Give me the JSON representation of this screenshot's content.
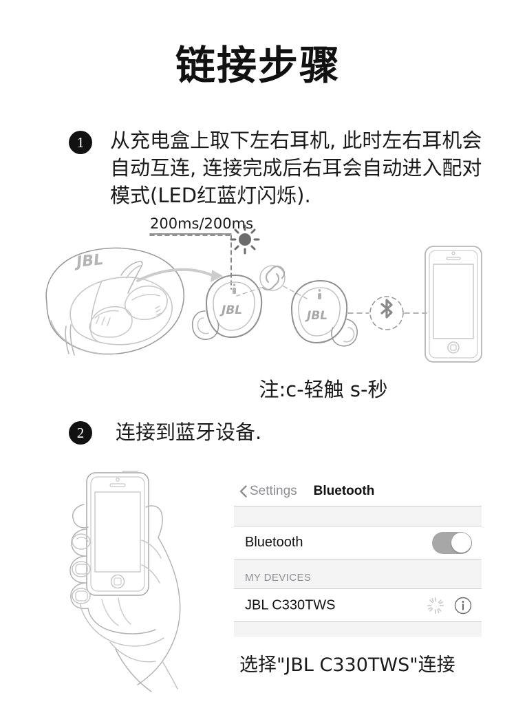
{
  "title": "链接步骤",
  "steps": [
    {
      "number": "1",
      "text": "从充电盒上取下左右耳机, 此时左右耳机会自动互连, 连接完成后右耳会自动进入配对模式(LED红蓝灯闪烁)."
    },
    {
      "number": "2",
      "text": "连接到蓝牙设备."
    }
  ],
  "diagram": {
    "blink_label": "200ms/200ms",
    "case_logo": "JBL",
    "earbud_left_logo": "JBL",
    "earbud_right_logo": "JBL"
  },
  "note": "注:c-轻触    s-秒",
  "ios": {
    "back_label": "Settings",
    "nav_title": "Bluetooth",
    "bluetooth_row_label": "Bluetooth",
    "bluetooth_toggle_state": "on",
    "section_header": "MY DEVICES",
    "device_name": "JBL  C330TWS",
    "device_status": "connecting"
  },
  "caption": "选择\"JBL  C330TWS\"连接",
  "colors": {
    "ink": "#1a1a1a",
    "line_art": "#9a9a9a",
    "line_art_light": "#c6c6c6",
    "panel_gray": "#f4f4f4",
    "separator": "#cfcfd1",
    "muted_text": "#8e8e93",
    "toggle_on": "#a7a7a7"
  }
}
